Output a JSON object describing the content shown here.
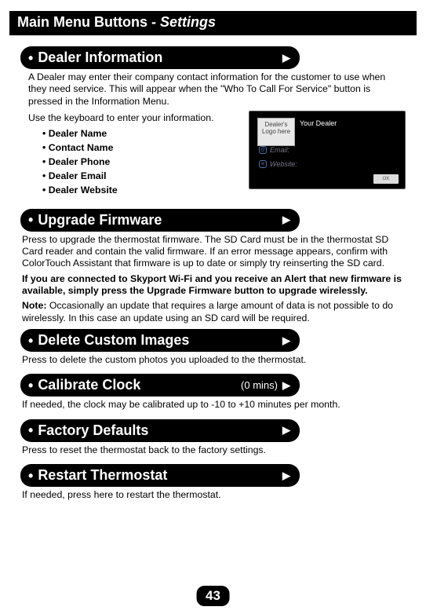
{
  "header": {
    "title": "Main Menu Buttons",
    "sep": " - ",
    "sub": "Settings"
  },
  "dealer": {
    "button": "Dealer Information",
    "desc1": "A Dealer may enter their company contact information for the customer to use when they need service. This will appear when the \"Who To Call For Service\" button is pressed in the Information Menu.",
    "kb": "Use the keyboard to enter your information.",
    "fields": [
      "Dealer Name",
      "Contact Name",
      "Dealer Phone",
      "Dealer Email",
      "Dealer Website"
    ],
    "screen": {
      "logo": "Dealer's Logo here",
      "f1": "Your Dealer",
      "f2": "Email:",
      "f3": "Website:",
      "ok": "OK"
    }
  },
  "upgrade": {
    "button": "Upgrade Firmware",
    "p1": "Press to upgrade the thermostat firmware. The SD Card must be in the thermostat SD Card reader and contain the valid firmware.  If an error message appears, confirm with ColorTouch Assistant that firmware is up to date or simply try reinserting the SD card.",
    "p2": "If you are connected to Skyport Wi-Fi and you receive an Alert that new firmware is available, simply press the Upgrade Firmware button to upgrade wirelessly.",
    "noteLabel": "Note:",
    "note": " Occasionally an update that requires a large amount of data is not possible to do wirelessly. In this case an update using an SD card will be required."
  },
  "delete": {
    "button": "Delete Custom Images",
    "desc": "Press to delete the custom photos you uploaded to the thermostat."
  },
  "clock": {
    "button": "Calibrate Clock",
    "aux": "(0 mins)",
    "desc": "If needed, the clock may be calibrated up to -10 to +10 minutes per month."
  },
  "factory": {
    "button": "Factory Defaults",
    "desc": "Press to reset the thermostat back to the factory settings."
  },
  "restart": {
    "button": "Restart Thermostat",
    "desc": "If needed, press here to restart the thermostat."
  },
  "pageNum": "43"
}
